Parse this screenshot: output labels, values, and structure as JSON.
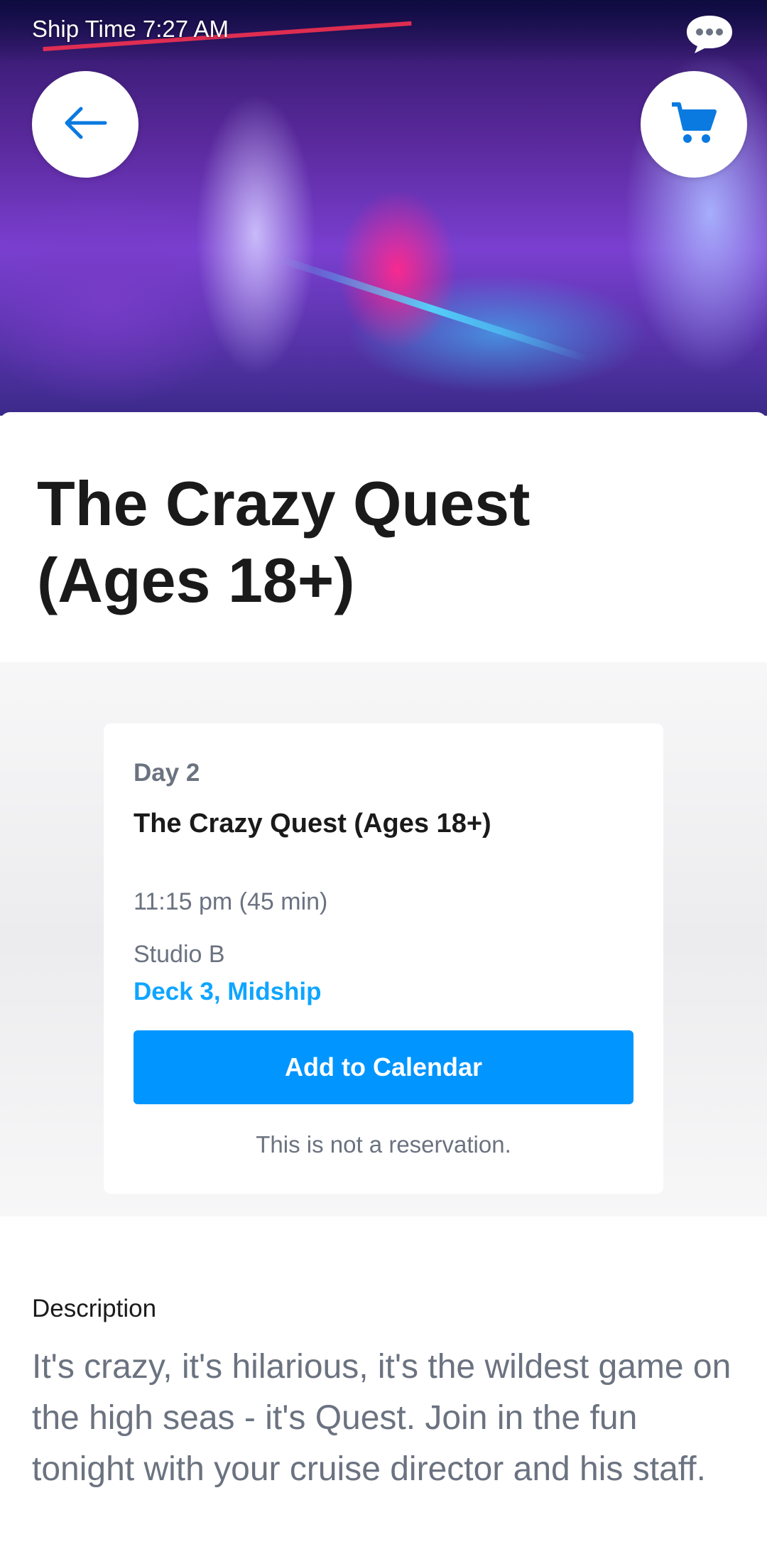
{
  "status": {
    "ship_time_label": "Ship Time",
    "ship_time_value": "7:27 AM"
  },
  "icons": {
    "back": "arrow-left-icon",
    "cart": "cart-icon",
    "chat": "chat-bubble-icon"
  },
  "colors": {
    "accent_blue": "#0095ff",
    "link_blue": "#0ea5ff",
    "muted_text": "#6b7280",
    "dark_text": "#1a1a1a"
  },
  "event": {
    "title": "The Crazy Quest (Ages 18+)",
    "day": "Day 2",
    "card_title": "The Crazy Quest (Ages 18+)",
    "time": "11:15 pm (45 min)",
    "venue": "Studio B",
    "location_link": "Deck 3, Midship",
    "add_to_calendar_label": "Add to Calendar",
    "reservation_note": "This is not a reservation."
  },
  "description": {
    "heading": "Description",
    "body": "It's crazy, it's hilarious, it's the wildest game on the high seas - it's Quest. Join in the fun tonight with your cruise director and his staff."
  }
}
